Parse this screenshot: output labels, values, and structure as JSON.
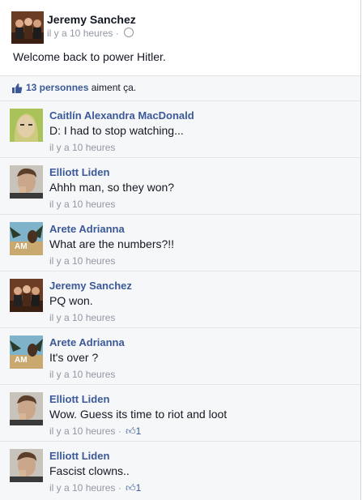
{
  "post": {
    "author": "Jeremy Sanchez",
    "time": "il y a 10 heures",
    "separator": " · ",
    "text": "Welcome back to power Hitler.",
    "privacy_icon": "globe-icon"
  },
  "likes": {
    "count_label": "13 personnes",
    "suffix": "aiment ça."
  },
  "comments": [
    {
      "author": "Caitlín Alexandra MacDonald",
      "text": "D: I had to stop watching...",
      "time": "il y a 10 heures",
      "likes": ""
    },
    {
      "author": "Elliott Liden",
      "text": "Ahhh man, so they won?",
      "time": "il y a 10 heures",
      "likes": ""
    },
    {
      "author": "Arete Adrianna",
      "text": "What are the numbers?!!",
      "time": "il y a 10 heures",
      "likes": ""
    },
    {
      "author": "Jeremy Sanchez",
      "text": "PQ won.",
      "time": "il y a 10 heures",
      "likes": ""
    },
    {
      "author": "Arete Adrianna",
      "text": "It's over ?",
      "time": "il y a 10 heures",
      "likes": ""
    },
    {
      "author": "Elliott Liden",
      "text": "Wow. Guess its time to riot and loot",
      "time": "il y a 10 heures",
      "likes": "1"
    },
    {
      "author": "Elliott Liden",
      "text": "Fascist clowns..",
      "time": "il y a 10 heures",
      "likes": "1"
    }
  ],
  "colors": {
    "link_blue": "#3b5998",
    "meta_gray": "#9197a3",
    "panel_bg": "#f6f7f8"
  }
}
